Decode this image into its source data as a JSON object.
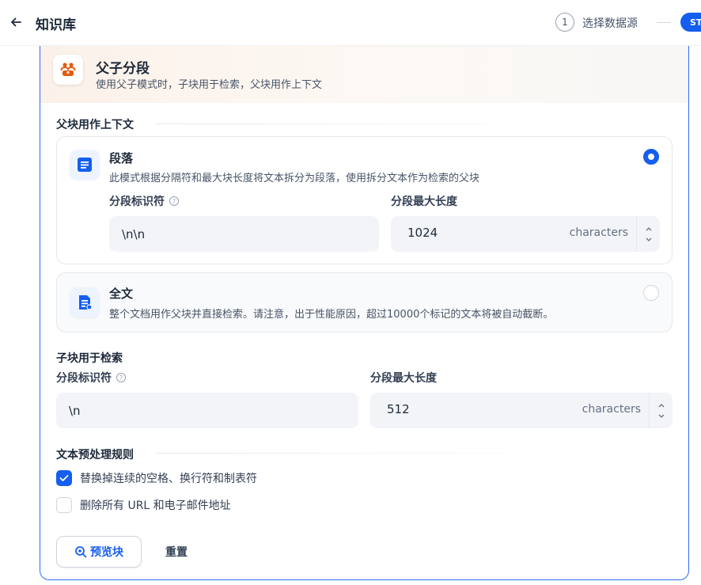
{
  "header": {
    "title": "知识库",
    "step_number": "1",
    "step_label": "选择数据源",
    "next_step_badge": "ST"
  },
  "mode": {
    "title": "父子分段",
    "description": "使用父子模式时，子块用于检索，父块用作上下文"
  },
  "parent_section": {
    "title": "父块用作上下文",
    "options": [
      {
        "title": "段落",
        "description": "此模式根据分隔符和最大块长度将文本拆分为段落，使用拆分文本作为检索的父块",
        "selected": true
      },
      {
        "title": "全文",
        "description": "整个文档用作父块并直接检索。请注意，出于性能原因，超过10000个标记的文本将被自动截断。",
        "selected": false
      }
    ],
    "delimiter_label": "分段标识符",
    "delimiter_value": "\\n\\n",
    "max_length_label": "分段最大长度",
    "max_length_value": "1024",
    "max_length_unit": "characters"
  },
  "child_section": {
    "title": "子块用于检索",
    "delimiter_label": "分段标识符",
    "delimiter_value": "\\n",
    "max_length_label": "分段最大长度",
    "max_length_value": "512",
    "max_length_unit": "characters"
  },
  "preprocessing": {
    "title": "文本预处理规则",
    "rules": [
      {
        "label": "替换掉连续的空格、换行符和制表符",
        "checked": true
      },
      {
        "label": "删除所有 URL 和电子邮件地址",
        "checked": false
      }
    ]
  },
  "actions": {
    "preview_label": "预览块",
    "reset_label": "重置"
  },
  "colors": {
    "accent": "#155eef",
    "mode_icon": "#e8590c"
  },
  "icons": {
    "back": "arrow-left-icon",
    "mode": "parent-child-icon",
    "paragraph": "paragraph-doc-icon",
    "fulltext": "fulltext-doc-icon",
    "help": "question-circle-icon",
    "preview": "search-eye-icon"
  }
}
